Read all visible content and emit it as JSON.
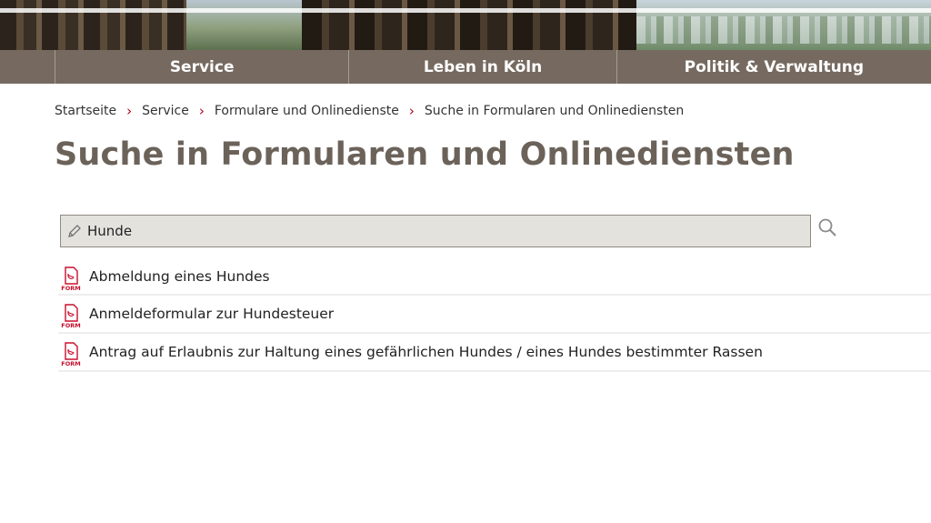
{
  "nav": {
    "items": [
      "Service",
      "Leben in Köln",
      "Politik & Verwaltung"
    ]
  },
  "breadcrumb": [
    "Startseite",
    "Service",
    "Formulare und Onlinedienste",
    "Suche in Formularen und Onlinediensten"
  ],
  "page_title": "Suche in Formularen und Onlinediensten",
  "search": {
    "value": "Hunde",
    "icon": "pencil-icon",
    "button_icon": "magnifier-icon"
  },
  "results": [
    {
      "label": "Abmeldung eines Hundes",
      "icon": "pdf-form-icon"
    },
    {
      "label": "Anmeldeformular zur Hundesteuer",
      "icon": "pdf-form-icon"
    },
    {
      "label": "Antrag auf Erlaubnis zur Haltung eines gefährlichen Hundes / eines Hundes bestimmter Rassen",
      "icon": "pdf-form-icon"
    }
  ],
  "colors": {
    "nav_bg": "#766a60",
    "title": "#6b625a",
    "crumb_separator": "#b0001e",
    "pdf_red": "#c8102e"
  }
}
